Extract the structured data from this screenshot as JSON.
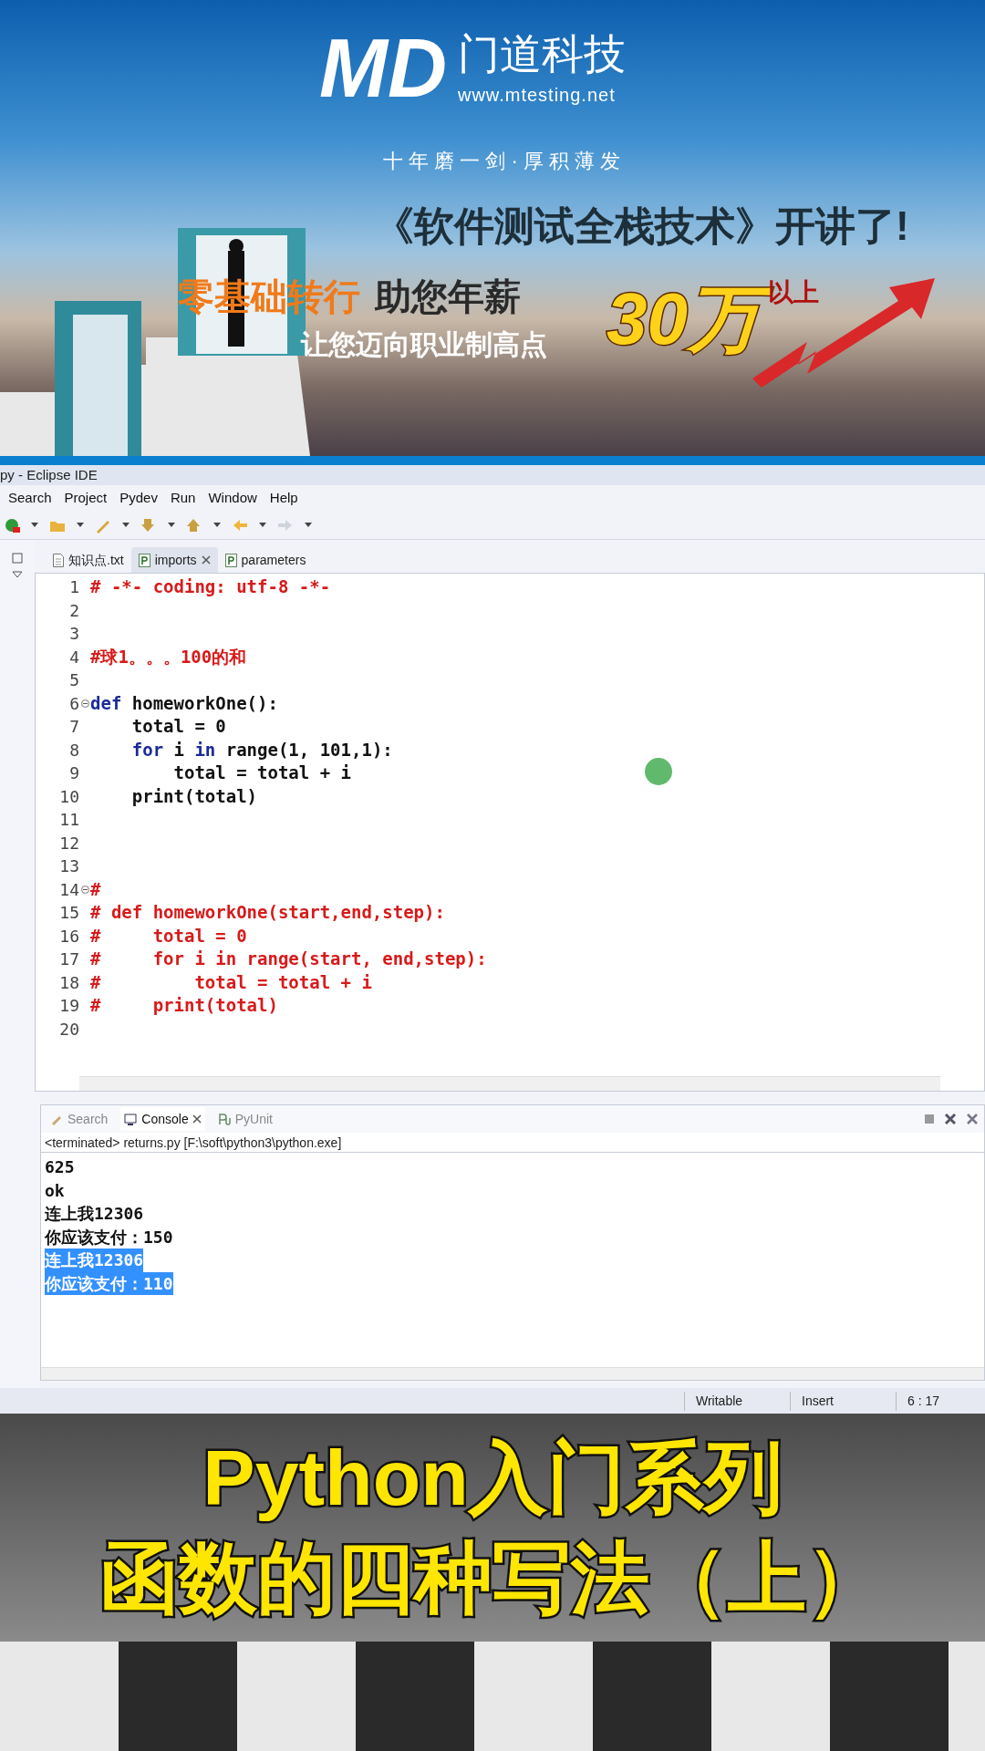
{
  "banner": {
    "logo": "MD",
    "brand": "门道科技",
    "url": "www.mtesting.net",
    "motto": "十 年 磨 一 剑 · 厚 积 薄 发",
    "headline": "《软件测试全栈技术》开讲了!",
    "pitch_orange": "零基础转行",
    "pitch_dark": "助您年薪",
    "subline": "让您迈向职业制高点",
    "salary": "30万",
    "salary_suffix": "以上"
  },
  "window": {
    "title": "py - Eclipse IDE"
  },
  "menu": [
    "Search",
    "Project",
    "Pydev",
    "Run",
    "Window",
    "Help"
  ],
  "editor_tabs": [
    {
      "label": "知识点.txt",
      "kind": "text",
      "selected": false,
      "closable": false
    },
    {
      "label": "imports",
      "kind": "python",
      "selected": true,
      "closable": true
    },
    {
      "label": "parameters",
      "kind": "python",
      "selected": false,
      "closable": false
    }
  ],
  "code_lines": [
    {
      "number": "1",
      "foldable": false,
      "segments": [
        {
          "kind": "comment",
          "text": "# -*- coding: utf-8 -*-"
        }
      ]
    },
    {
      "number": "2",
      "foldable": false
    },
    {
      "number": "3",
      "foldable": false
    },
    {
      "number": "4",
      "foldable": false,
      "segments": [
        {
          "kind": "comment",
          "text": "#球1。。。100的和"
        }
      ]
    },
    {
      "number": "5",
      "foldable": false
    },
    {
      "number": "6",
      "foldable": true,
      "segments": [
        {
          "kind": "keyword",
          "text": "def "
        },
        {
          "kind": "plain",
          "text": "homeworkOne():"
        }
      ]
    },
    {
      "number": "7",
      "foldable": false,
      "segments": [
        {
          "kind": "plain",
          "text": "    total = 0"
        }
      ]
    },
    {
      "number": "8",
      "foldable": false,
      "segments": [
        {
          "kind": "keyword",
          "text": "    for "
        },
        {
          "kind": "plain",
          "text": "i "
        },
        {
          "kind": "keyword",
          "text": "in "
        },
        {
          "kind": "plain",
          "text": "range(1, 101,1):"
        }
      ]
    },
    {
      "number": "9",
      "foldable": false,
      "segments": [
        {
          "kind": "plain",
          "text": "        total = total + i"
        }
      ]
    },
    {
      "number": "10",
      "foldable": false,
      "segments": [
        {
          "kind": "plain",
          "text": "    print(total)"
        }
      ]
    },
    {
      "number": "11",
      "foldable": false
    },
    {
      "number": "12",
      "foldable": false
    },
    {
      "number": "13",
      "foldable": false
    },
    {
      "number": "14",
      "foldable": true,
      "segments": [
        {
          "kind": "comment",
          "text": "#"
        }
      ]
    },
    {
      "number": "15",
      "foldable": false,
      "segments": [
        {
          "kind": "comment",
          "text": "# def homeworkOne(start,end,step):"
        }
      ]
    },
    {
      "number": "16",
      "foldable": false,
      "segments": [
        {
          "kind": "comment",
          "text": "#     total = 0"
        }
      ]
    },
    {
      "number": "17",
      "foldable": false,
      "segments": [
        {
          "kind": "comment",
          "text": "#     for i in range(start, end,step):"
        }
      ]
    },
    {
      "number": "18",
      "foldable": false,
      "segments": [
        {
          "kind": "comment",
          "text": "#         total = total + i"
        }
      ]
    },
    {
      "number": "19",
      "foldable": false,
      "segments": [
        {
          "kind": "comment",
          "text": "#     print(total)"
        }
      ]
    },
    {
      "number": "20",
      "foldable": false
    }
  ],
  "console_tabs": [
    {
      "label": "Search",
      "kind": "search",
      "selected": false,
      "closable": false
    },
    {
      "label": "Console",
      "kind": "console",
      "selected": true,
      "closable": true
    },
    {
      "label": "PyUnit",
      "kind": "pyunit",
      "selected": false,
      "closable": false
    }
  ],
  "console_header": "<terminated> returns.py [F:\\soft\\python3\\python.exe]",
  "console_lines": [
    {
      "text": "625",
      "selected": false
    },
    {
      "text": "ok",
      "selected": false
    },
    {
      "text": "连上我12306",
      "selected": false
    },
    {
      "text": "你应该支付：150",
      "selected": false
    },
    {
      "text": "连上我12306",
      "selected": true
    },
    {
      "text": "你应该支付：110",
      "selected": true
    }
  ],
  "status_bar": [
    "Writable",
    "Insert",
    "6 : 17"
  ],
  "caption": [
    "Python入门系列",
    "函数的四种写法（上）"
  ]
}
